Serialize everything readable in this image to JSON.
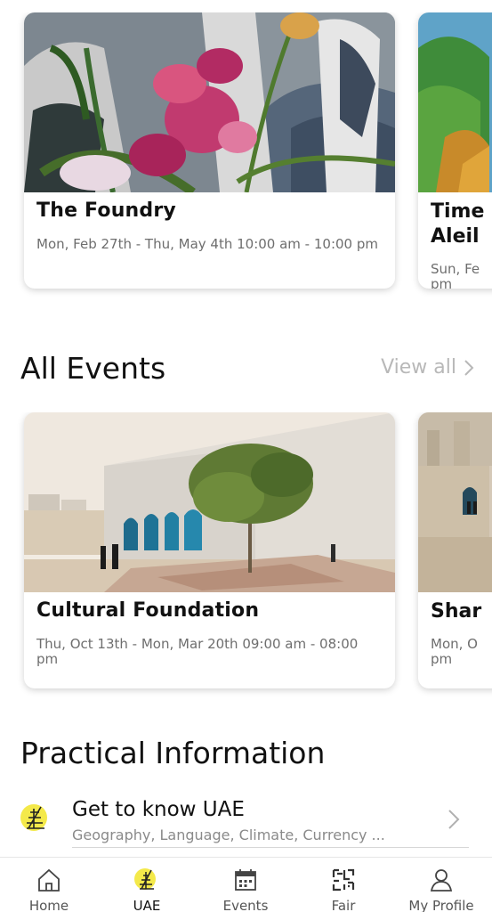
{
  "featured": {
    "card": {
      "title": "The Foundry",
      "dates": "Mon, Feb 27th - Thu, May 4th 10:00 am - 10:00 pm"
    },
    "peek": {
      "title": "Time Aleil",
      "dates": "Sun, Fe pm"
    }
  },
  "all_events": {
    "title": "All Events",
    "view_all": "View all",
    "card": {
      "title": "Cultural Foundation",
      "dates": "Thu, Oct 13th - Mon, Mar 20th 09:00 am - 08:00 pm"
    },
    "peek": {
      "title": "Shar",
      "dates": "Mon, O pm"
    }
  },
  "practical": {
    "title": "Practical Information",
    "item": {
      "title": "Get to know UAE",
      "subtitle": "Geography, Language, Climate, Currency ..."
    }
  },
  "tabbar": {
    "items": [
      {
        "label": "Home",
        "icon": "home-icon"
      },
      {
        "label": "UAE",
        "icon": "uae-icon"
      },
      {
        "label": "Events",
        "icon": "calendar-icon"
      },
      {
        "label": "Fair",
        "icon": "fair-icon"
      },
      {
        "label": "My Profile",
        "icon": "profile-icon"
      }
    ],
    "active": "UAE"
  },
  "colors": {
    "accent": "#f4e94a",
    "muted_text": "#6e6e6e",
    "view_all": "#b8b8b8"
  }
}
